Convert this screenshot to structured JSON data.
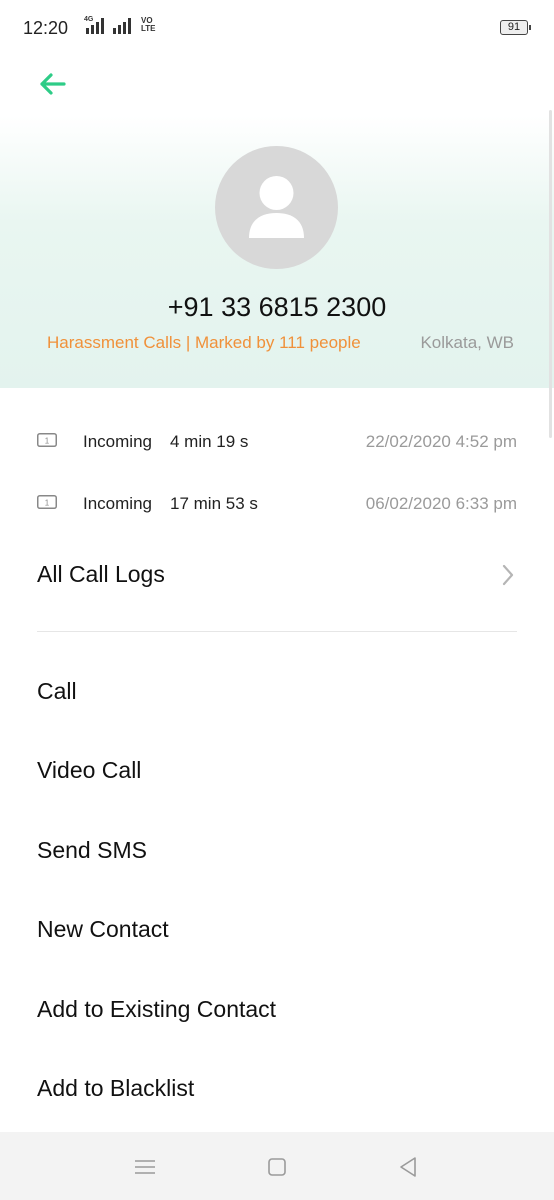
{
  "status_bar": {
    "time": "12:20",
    "network": "4G",
    "volte": "VO LTE",
    "battery": "91"
  },
  "header": {
    "phone_number": "+91 33 6815 2300",
    "tag": "Harassment Calls | Marked by 111 people",
    "location": "Kolkata, WB",
    "accent_color": "#2ecc87",
    "tag_color": "#f0913a"
  },
  "call_logs": [
    {
      "type": "Incoming",
      "duration": "4  min 19 s",
      "datetime": "22/02/2020 4:52 pm",
      "sim": "1"
    },
    {
      "type": "Incoming",
      "duration": "17  min 53 s",
      "datetime": "06/02/2020 6:33 pm",
      "sim": "1"
    }
  ],
  "all_call_logs_label": "All Call Logs",
  "actions": [
    {
      "label": "Call"
    },
    {
      "label": "Video Call"
    },
    {
      "label": "Send SMS"
    },
    {
      "label": "New Contact"
    },
    {
      "label": "Add to Existing Contact"
    },
    {
      "label": "Add to Blacklist"
    }
  ],
  "icons": {
    "back": "arrow-left-icon",
    "avatar": "person-icon",
    "sim": "sim-card-icon",
    "chevron": "chevron-right-icon",
    "nav_menu": "menu-icon",
    "nav_home": "home-square-icon",
    "nav_back": "triangle-back-icon"
  }
}
